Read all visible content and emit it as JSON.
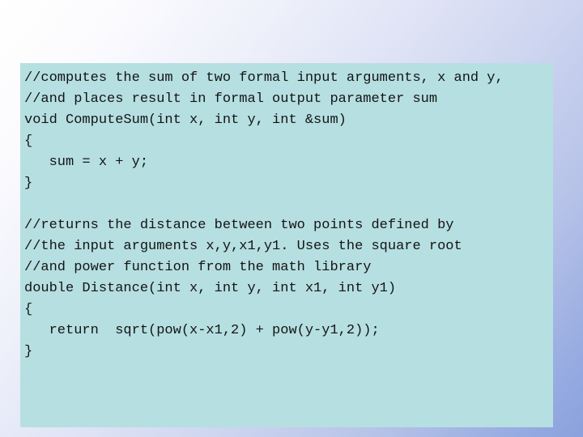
{
  "slide": {
    "background": {
      "start_color": "#ffffff",
      "end_color": "#8aa1dd"
    },
    "code_panel": {
      "background_color": "#b6dfe1",
      "text_color": "#141414",
      "language": "cpp",
      "lines": [
        "//computes the sum of two formal input arguments, x and y,",
        "//and places result in formal output parameter sum",
        "void ComputeSum(int x, int y, int &sum)",
        "{",
        "   sum = x + y;",
        "}",
        "",
        "//returns the distance between two points defined by",
        "//the input arguments x,y,x1,y1. Uses the square root",
        "//and power function from the math library",
        "double Distance(int x, int y, int x1, int y1)",
        "{",
        "   return  sqrt(pow(x-x1,2) + pow(y-y1,2));",
        "}"
      ]
    }
  }
}
